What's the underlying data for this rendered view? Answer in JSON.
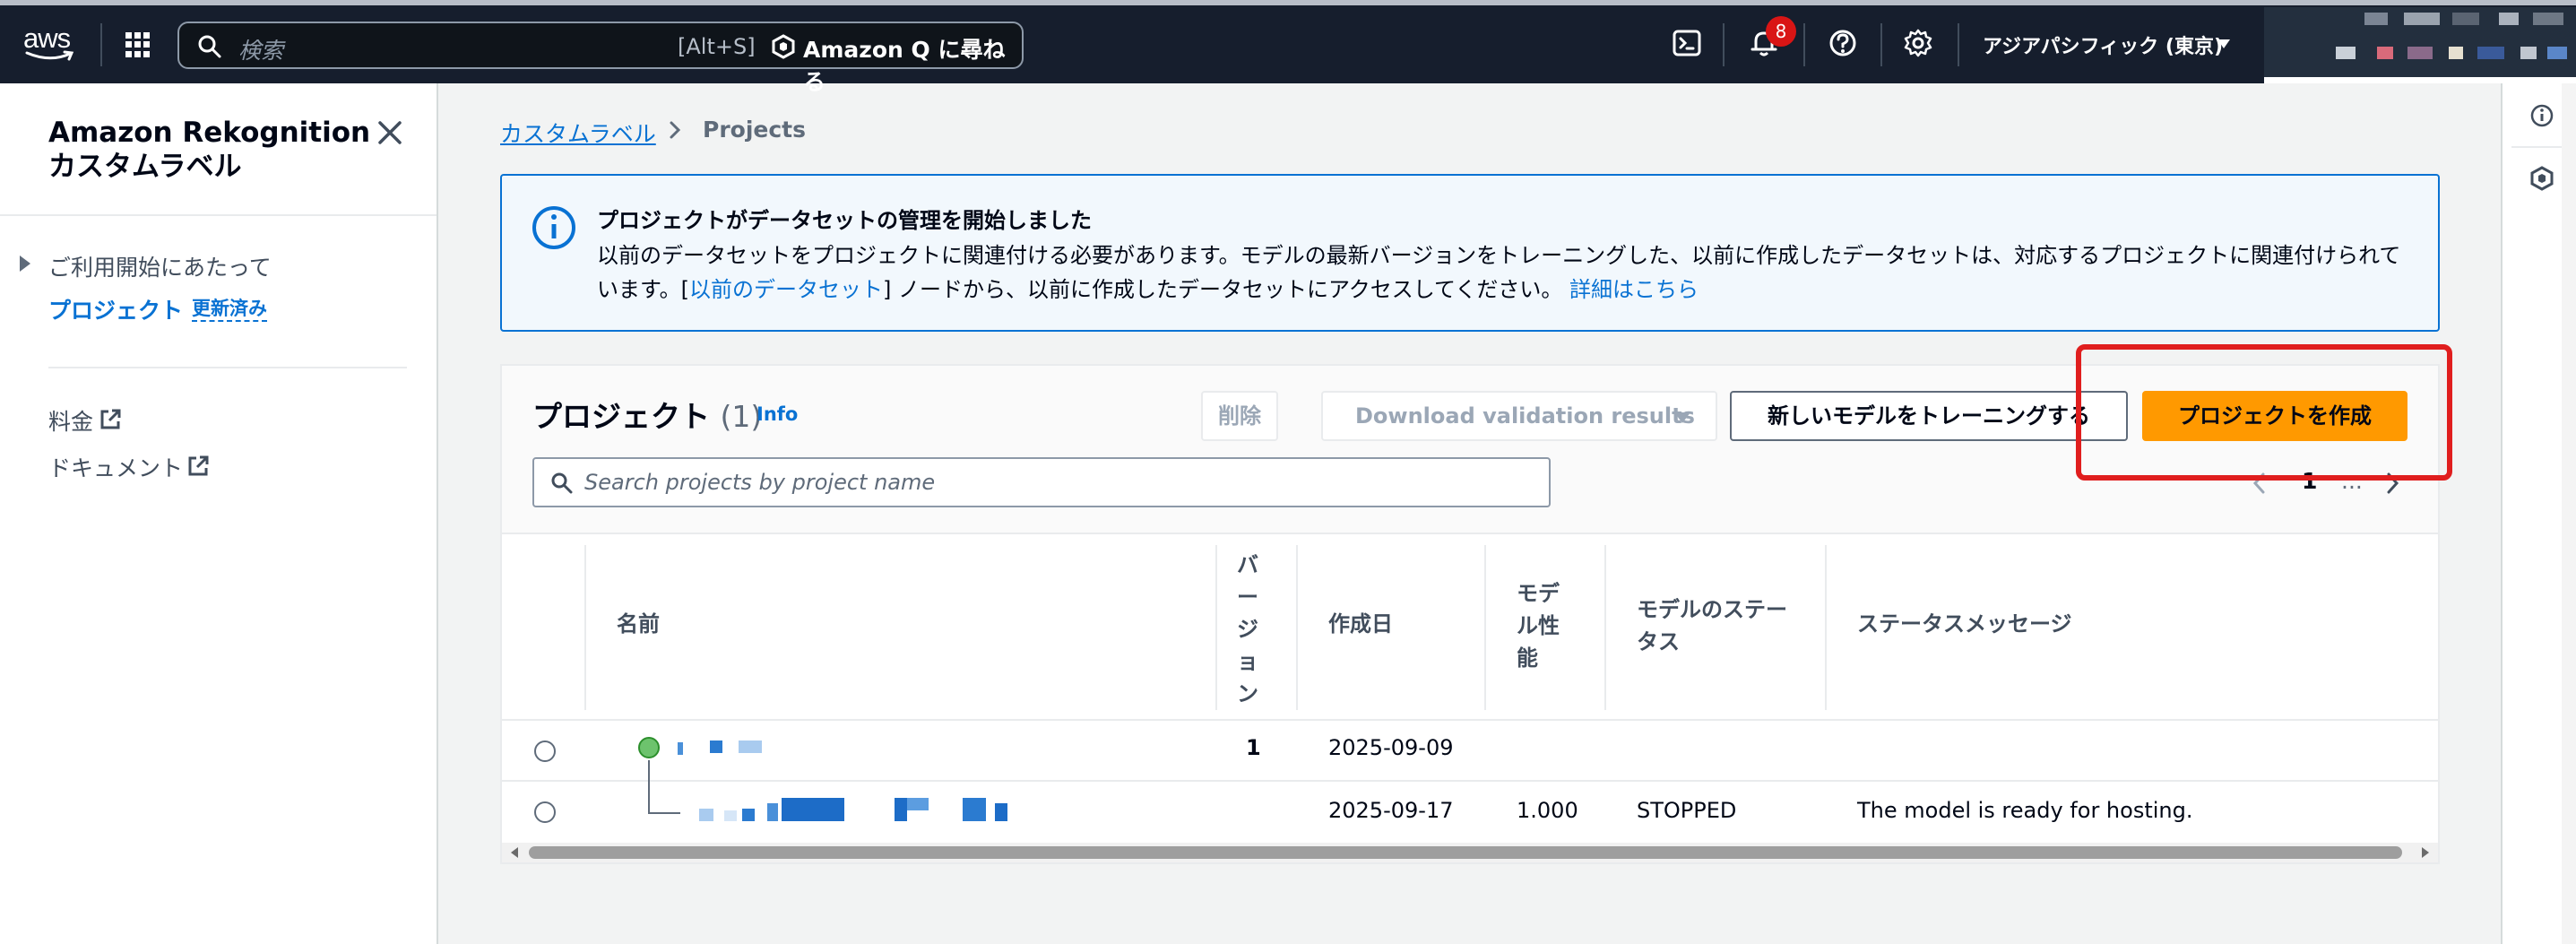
{
  "topbar": {
    "logo_text": "aws",
    "search_placeholder": "検索",
    "search_shortcut": "[Alt+S]",
    "ask_q": "Amazon Q に尋ねる",
    "notifications_count": "8",
    "region": "アジアパシフィック (東京)",
    "icons": [
      "grid-icon",
      "search-icon",
      "cloudshell-icon",
      "bell-icon",
      "help-icon",
      "gear-icon"
    ]
  },
  "sidenav": {
    "title": "Amazon Rekognition カスタムラベル",
    "items": [
      {
        "label": "ご利用開始にあたって"
      },
      {
        "label": "プロジェクト",
        "badge": "更新済み"
      },
      {
        "label": "料金"
      },
      {
        "label": "ドキュメント"
      }
    ]
  },
  "breadcrumb": {
    "parent": "カスタムラベル",
    "current": "Projects"
  },
  "banner": {
    "title": "プロジェクトがデータセットの管理を開始しました",
    "text_before": "以前のデータセットをプロジェクトに関連付ける必要があります。モデルの最新バージョンをトレーニングした、以前に作成したデータセットは、対応するプロジェクトに関連付けられています。[",
    "link_datasets": "以前のデータセット",
    "text_after": "] ノードから、以前に作成したデータセットにアクセスしてください。",
    "link_more": "詳細はこちら"
  },
  "projects": {
    "title": "プロジェクト",
    "count": "(1)",
    "info": "Info",
    "buttons": {
      "delete": "削除",
      "download": "Download validation results",
      "train": "新しいモデルをトレーニングする",
      "create": "プロジェクトを作成"
    },
    "search_placeholder": "Search projects by project name",
    "pagination": {
      "page": "1",
      "dots": "..."
    },
    "columns": [
      "名前",
      "バージョン",
      "作成日",
      "モデル性能",
      "モデルのステータス",
      "ステータスメッセージ"
    ],
    "rows": [
      {
        "version": "1",
        "created": "2025-09-09",
        "performance": "",
        "status": "",
        "message": ""
      },
      {
        "version": "",
        "created": "2025-09-17",
        "performance": "1.000",
        "status": "STOPPED",
        "message": "The model is ready for hosting."
      }
    ]
  },
  "colors": {
    "nav_bg": "#161e2d",
    "link": "#0972d3",
    "primary": "#ff9900",
    "highlight": "#e01e1e"
  }
}
